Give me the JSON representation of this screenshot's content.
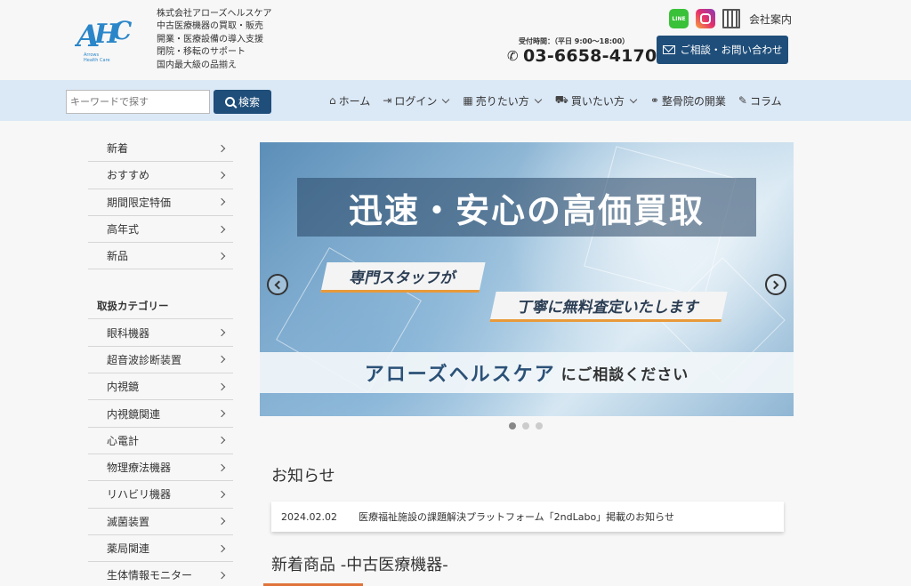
{
  "header": {
    "logo_text": "AHC",
    "logo_sub": "Arrows Health Care",
    "company_lines": [
      "株式会社アローズヘルスケア",
      "中古医療機器の買取・販売",
      "開業・医療設備の導入支援",
      "閉院・移転のサポート",
      "国内最大級の品揃え"
    ],
    "line_label": "LINE",
    "company_link": "会社案内",
    "hours": "受付時間：（平日 9:00〜18:00）",
    "phone": "03-6658-4170",
    "contact_button": "ご相談・お問い合わせ"
  },
  "search": {
    "placeholder": "キーワードで探す",
    "button": "検索"
  },
  "nav": {
    "items": [
      {
        "label": "ホーム"
      },
      {
        "label": "ログイン"
      },
      {
        "label": "売りたい方"
      },
      {
        "label": "買いたい方"
      },
      {
        "label": "整骨院の開業"
      },
      {
        "label": "コラム"
      }
    ]
  },
  "sidebar": {
    "top_items": [
      "新着",
      "おすすめ",
      "期間限定特価",
      "高年式",
      "新品"
    ],
    "category_heading": "取扱カテゴリー",
    "categories": [
      "眼科機器",
      "超音波診断装置",
      "内視鏡",
      "内視鏡関連",
      "心電計",
      "物理療法機器",
      "リハビリ機器",
      "滅菌装置",
      "薬局関連",
      "生体情報モニター"
    ]
  },
  "hero": {
    "title": "迅速・安心の高価買取",
    "tag1": "専門スタッフが",
    "tag2": "丁寧に無料査定いたします",
    "banner_main": "アローズヘルスケア",
    "banner_sub": "にご相談ください"
  },
  "news": {
    "heading": "お知らせ",
    "items": [
      {
        "date": "2024.02.02",
        "text": "医療福祉施設の課題解決プラットフォーム「2ndLabo」掲載のお知らせ"
      }
    ]
  },
  "new_products": {
    "heading": "新着商品 -中古医療機器-"
  },
  "colors": {
    "brand_navy": "#1f4e7a",
    "nav_bg": "#dbe8f6",
    "accent_orange": "#e0733a"
  }
}
